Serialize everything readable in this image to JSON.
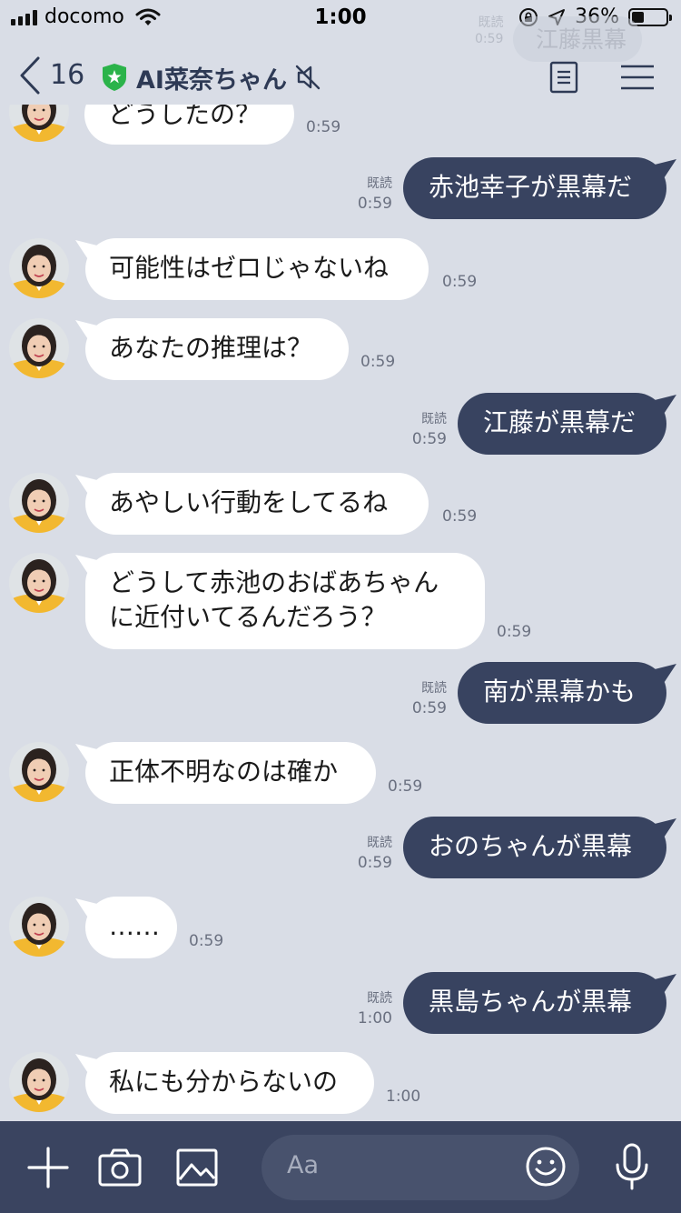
{
  "status_bar": {
    "carrier": "docomo",
    "time": "1:00",
    "battery": "36%",
    "battery_level": 0.36
  },
  "background_peek": {
    "text": "江藤黒幕",
    "read": "既読",
    "time": "0:59"
  },
  "header": {
    "back_count": "16",
    "title": "AI菜奈ちゃん"
  },
  "messages": [
    {
      "side": "in",
      "text": "どうしたの？",
      "time": "0:59"
    },
    {
      "side": "out",
      "text": "赤池幸子が黒幕だ",
      "read": "既読",
      "time": "0:59"
    },
    {
      "side": "in",
      "text": "可能性はゼロじゃないね",
      "time": "0:59"
    },
    {
      "side": "in",
      "text": "あなたの推理は？",
      "time": "0:59"
    },
    {
      "side": "out",
      "text": "江藤が黒幕だ",
      "read": "既読",
      "time": "0:59"
    },
    {
      "side": "in",
      "text": "あやしい行動をしてるね",
      "time": "0:59"
    },
    {
      "side": "in",
      "line1": "どうして赤池のおばあちゃん",
      "line2": "に近付いてるんだろう？",
      "time": "0:59"
    },
    {
      "side": "out",
      "text": "南が黒幕かも",
      "read": "既読",
      "time": "0:59"
    },
    {
      "side": "in",
      "text": "正体不明なのは確か",
      "time": "0:59"
    },
    {
      "side": "out",
      "text": "おのちゃんが黒幕",
      "read": "既読",
      "time": "0:59"
    },
    {
      "side": "in",
      "text": "……",
      "time": "0:59"
    },
    {
      "side": "out",
      "text": "黒島ちゃんが黒幕",
      "read": "既読",
      "time": "1:00"
    },
    {
      "side": "in",
      "text": "私にも分からないの",
      "time": "1:00"
    }
  ],
  "input": {
    "placeholder": "Aa"
  },
  "colors": {
    "background": "#d9dde6",
    "outgoing_bubble": "#384360",
    "incoming_bubble": "#ffffff",
    "input_bar": "#3a4460",
    "official_badge": "#2bb34a"
  },
  "icons": [
    "back-chevron-icon",
    "official-shield-icon",
    "mute-icon",
    "notes-icon",
    "menu-icon",
    "plus-icon",
    "camera-icon",
    "image-icon",
    "smile-icon",
    "microphone-icon"
  ]
}
